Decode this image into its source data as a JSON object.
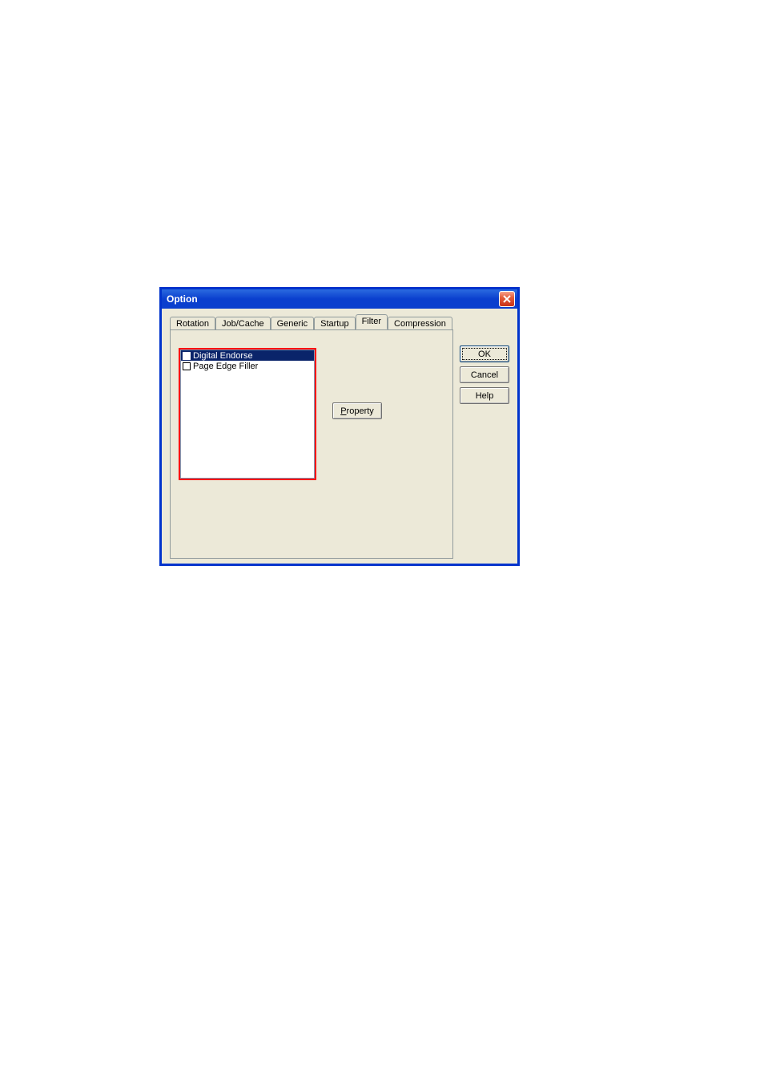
{
  "window": {
    "title": "Option"
  },
  "tabs": [
    {
      "label": "Rotation"
    },
    {
      "label": "Job/Cache"
    },
    {
      "label": "Generic"
    },
    {
      "label": "Startup"
    },
    {
      "label": "Filter"
    },
    {
      "label": "Compression"
    }
  ],
  "filter_list": {
    "items": [
      {
        "label": "Digital Endorse",
        "checked": false,
        "selected": true
      },
      {
        "label": "Page Edge Filler",
        "checked": false,
        "selected": false
      }
    ]
  },
  "buttons": {
    "property": "Property",
    "property_accel": "P",
    "ok": "OK",
    "cancel": "Cancel",
    "help": "Help"
  }
}
